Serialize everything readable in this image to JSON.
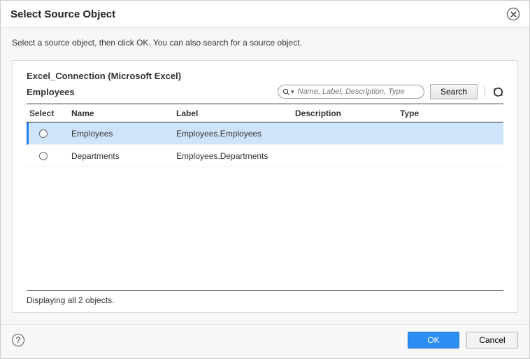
{
  "dialog": {
    "title": "Select Source Object",
    "instruction": "Select a source object, then click OK. You can also search for a source object."
  },
  "connection": {
    "label": "Excel_Connection (Microsoft Excel)",
    "entity": "Employees"
  },
  "search": {
    "placeholder": "Name, Label, Description, Type",
    "button": "Search"
  },
  "table": {
    "headers": {
      "select": "Select",
      "name": "Name",
      "label": "Label",
      "description": "Description",
      "type": "Type"
    },
    "rows": [
      {
        "name": "Employees",
        "label": "Employees.Employees",
        "description": "",
        "type": "",
        "selected": true
      },
      {
        "name": "Departments",
        "label": "Employees.Departments",
        "description": "",
        "type": "",
        "selected": false
      }
    ]
  },
  "status": "Displaying all 2 objects.",
  "footer": {
    "ok": "OK",
    "cancel": "Cancel"
  }
}
